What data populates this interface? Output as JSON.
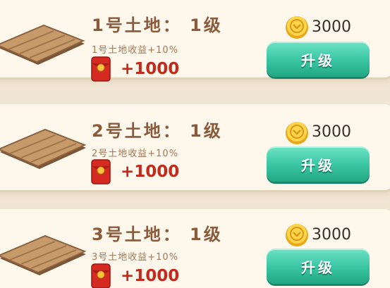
{
  "colors": {
    "background": "#f1e6d3",
    "card": "#fdf7ec",
    "title_text": "#8a5a3a",
    "reward_text": "#c22a1c",
    "button": "#3cc7a4",
    "coin": "#f2b62a"
  },
  "plots": [
    {
      "title": "1号土地： 1级",
      "income_text": "1号土地收益+10%",
      "reward": "+1000",
      "cost": "3000",
      "button_label": "升级",
      "plot_icon": "wooden-plot-icon",
      "reward_icon": "red-envelope-icon",
      "cost_icon": "gold-coin-icon"
    },
    {
      "title": "2号土地： 1级",
      "income_text": "2号土地收益+10%",
      "reward": "+1000",
      "cost": "3000",
      "button_label": "升级",
      "plot_icon": "wooden-plot-icon",
      "reward_icon": "red-envelope-icon",
      "cost_icon": "gold-coin-icon"
    },
    {
      "title": "3号土地： 1级",
      "income_text": "3号土地收益+10%",
      "reward": "+1000",
      "cost": "3000",
      "button_label": "升级",
      "plot_icon": "wooden-plot-icon",
      "reward_icon": "red-envelope-icon",
      "cost_icon": "gold-coin-icon"
    }
  ]
}
